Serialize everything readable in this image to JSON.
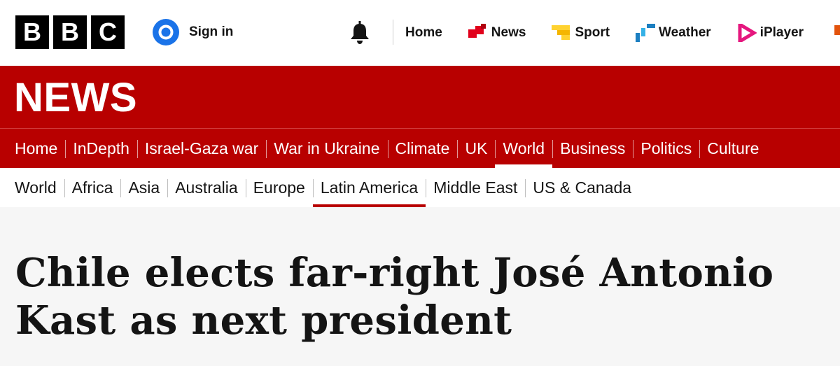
{
  "header": {
    "logo_letters": [
      "B",
      "B",
      "C"
    ],
    "signin_label": "Sign in",
    "nav": [
      {
        "label": "Home",
        "icon": "none"
      },
      {
        "label": "News",
        "icon": "news-icon",
        "color": "#e1001b"
      },
      {
        "label": "Sport",
        "icon": "sport-icon",
        "color": "#ffd230"
      },
      {
        "label": "Weather",
        "icon": "weather-icon",
        "color": "#1c7fc1"
      },
      {
        "label": "iPlayer",
        "icon": "iplayer-icon",
        "color": "#e5177e"
      }
    ]
  },
  "section": {
    "title": "NEWS",
    "color": "#b80000"
  },
  "primary_nav": [
    {
      "label": "Home"
    },
    {
      "label": "InDepth"
    },
    {
      "label": "Israel-Gaza war"
    },
    {
      "label": "War in Ukraine"
    },
    {
      "label": "Climate"
    },
    {
      "label": "UK"
    },
    {
      "label": "World",
      "active": true
    },
    {
      "label": "Business"
    },
    {
      "label": "Politics"
    },
    {
      "label": "Culture"
    }
  ],
  "secondary_nav": [
    {
      "label": "World"
    },
    {
      "label": "Africa"
    },
    {
      "label": "Asia"
    },
    {
      "label": "Australia"
    },
    {
      "label": "Europe"
    },
    {
      "label": "Latin America",
      "active": true
    },
    {
      "label": "Middle East"
    },
    {
      "label": "US & Canada"
    }
  ],
  "article": {
    "headline": "Chile elects far-right José Antonio Kast as next president"
  }
}
